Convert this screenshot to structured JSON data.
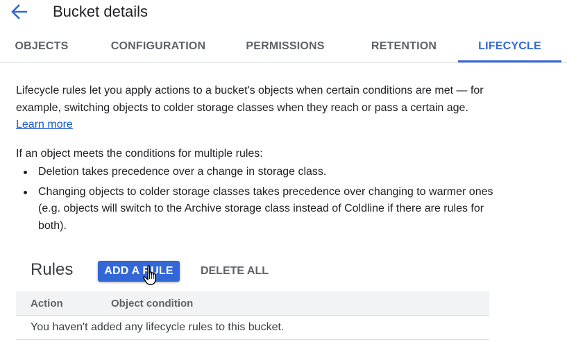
{
  "header": {
    "title": "Bucket details",
    "back_icon": "arrow-back-icon"
  },
  "tabs": [
    {
      "label": "OBJECTS",
      "active": false
    },
    {
      "label": "CONFIGURATION",
      "active": false
    },
    {
      "label": "PERMISSIONS",
      "active": false
    },
    {
      "label": "RETENTION",
      "active": false
    },
    {
      "label": "LIFECYCLE",
      "active": true
    }
  ],
  "description": {
    "text": "Lifecycle rules let you apply actions to a bucket's objects when certain conditions are met — for example, switching objects to colder storage classes when they reach or pass a certain age.",
    "link": "Learn more"
  },
  "conditions": {
    "intro": "If an object meets the conditions for multiple rules:",
    "items": [
      "Deletion takes precedence over a change in storage class.",
      "Changing objects to colder storage classes takes precedence over changing to warmer ones (e.g. objects will switch to the Archive storage class instead of Coldline if there are rules for both)."
    ]
  },
  "rules": {
    "title": "Rules",
    "add_label": "ADD A RULE",
    "delete_label": "DELETE ALL",
    "columns": [
      "Action",
      "Object condition"
    ],
    "empty_message": "You haven't added any lifecycle rules to this bucket."
  },
  "colors": {
    "accent": "#3367d6",
    "link": "#1a57c8",
    "muted_text": "#5f6368",
    "table_header_bg": "#f1f3f4"
  }
}
